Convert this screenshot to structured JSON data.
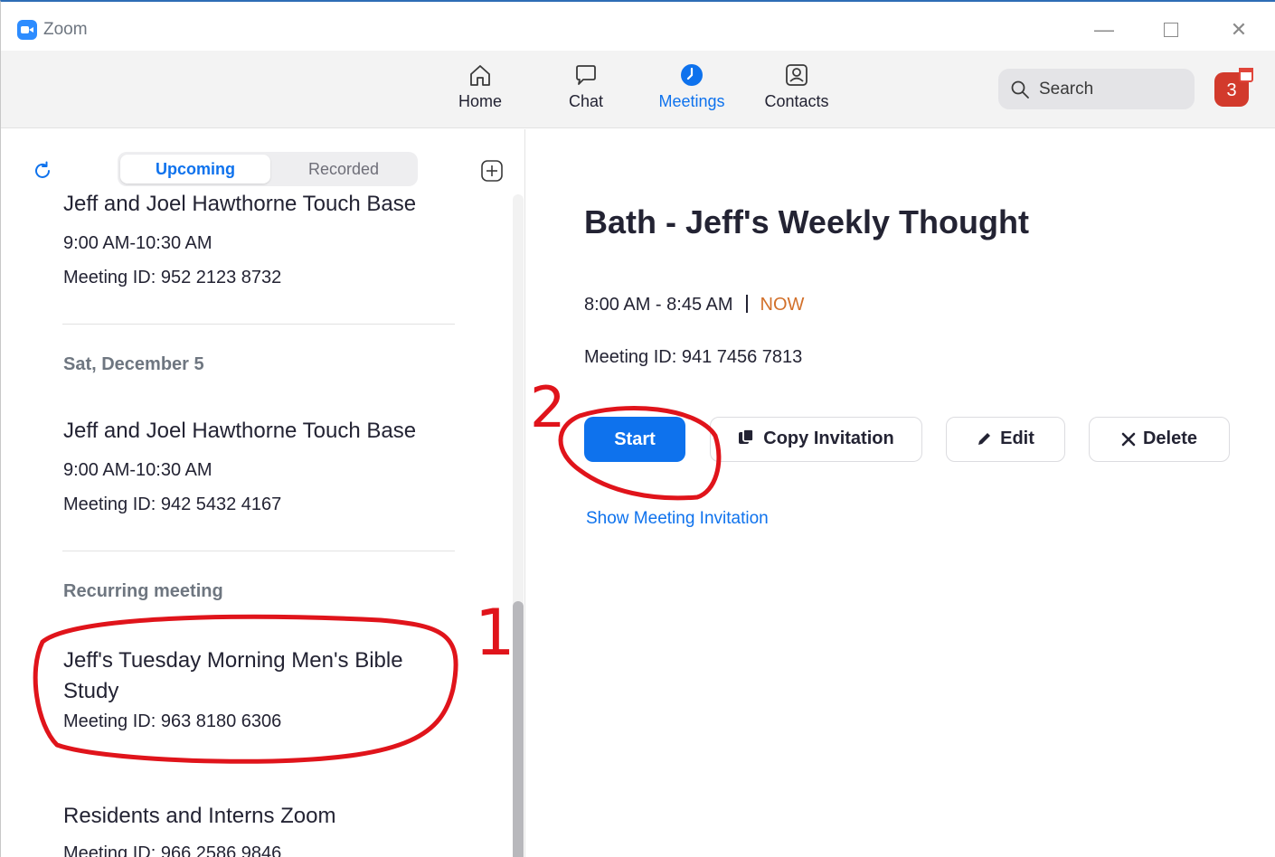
{
  "window": {
    "title": "Zoom"
  },
  "nav": {
    "tabs": [
      {
        "label": "Home",
        "icon": "home-icon"
      },
      {
        "label": "Chat",
        "icon": "chat-icon"
      },
      {
        "label": "Meetings",
        "icon": "clock-icon",
        "active": true
      },
      {
        "label": "Contacts",
        "icon": "contacts-icon"
      }
    ],
    "search_label": "Search",
    "avatar_initial": "3"
  },
  "colors": {
    "accent": "#0e72ed",
    "now": "#d2702a",
    "annotation": "#e0141b",
    "avatar": "#d23a2c"
  },
  "list": {
    "tabs": {
      "upcoming": "Upcoming",
      "recorded": "Recorded"
    },
    "items": [
      {
        "title": "Jeff and Joel Hawthorne Touch Base",
        "time": "9:00 AM-10:30 AM",
        "meeting_id": "Meeting ID: 952 2123 8732"
      },
      {
        "title": "Jeff and Joel Hawthorne Touch Base",
        "time": "9:00 AM-10:30 AM",
        "meeting_id": "Meeting ID: 942 5432 4167"
      },
      {
        "title": "Jeff's Tuesday Morning Men's Bible Study",
        "meeting_id": "Meeting ID: 963 8180 6306"
      },
      {
        "title": "Residents and Interns Zoom",
        "meeting_id": "Meeting ID: 966 2586 9846"
      }
    ],
    "sections": [
      "Sat, December 5",
      "Recurring meeting"
    ]
  },
  "detail": {
    "title": "Bath - Jeff's Weekly Thought",
    "time": "8:00 AM - 8:45 AM",
    "status": "NOW",
    "meeting_id": "Meeting ID: 941 7456 7813",
    "buttons": {
      "start": "Start",
      "copy": "Copy Invitation",
      "edit": "Edit",
      "delete": "Delete"
    },
    "show_invitation": "Show Meeting Invitation"
  },
  "annotations": {
    "one": "1",
    "two": "2"
  }
}
